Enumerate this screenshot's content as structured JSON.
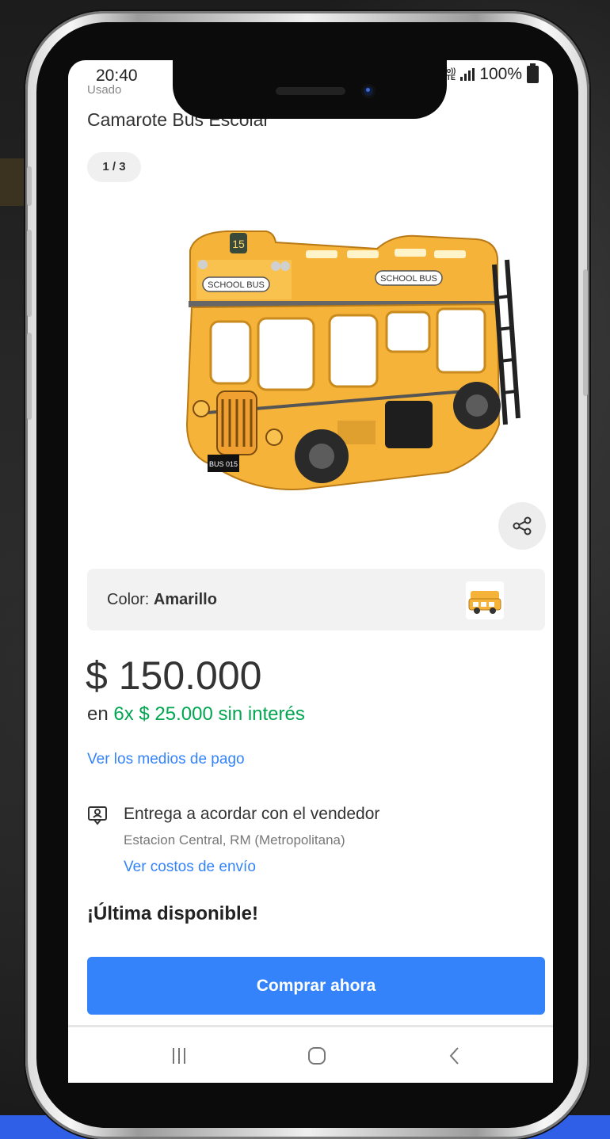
{
  "status_bar": {
    "time": "20:40",
    "network": "Vo)) LTE",
    "battery_percent": "100%"
  },
  "product": {
    "condition": "Usado",
    "title": "Camarote Bus Escolar",
    "image_counter": "1 / 3",
    "image_label": "SCHOOL BUS",
    "image_number": "15",
    "image_plate": "BUS 015",
    "color_label": "Color:",
    "color_value": "Amarillo",
    "price": "$ 150.000",
    "installments_prefix": "en ",
    "installments_highlight": "6x $ 25.000 sin interés",
    "payment_link": "Ver los medios de pago",
    "delivery_title": "Entrega a acordar con el vendedor",
    "delivery_location": "Estacion Central, RM (Metropolitana)",
    "shipping_link": "Ver costos de envío",
    "stock_label": "¡Última disponible!",
    "buy_button": "Comprar ahora"
  },
  "colors": {
    "accent_blue": "#3483fa",
    "installments_green": "#00a650",
    "bus_yellow": "#f5b33a"
  },
  "icons": [
    "share-icon",
    "delivery-icon",
    "nav-recents-icon",
    "nav-home-icon",
    "nav-back-icon"
  ]
}
